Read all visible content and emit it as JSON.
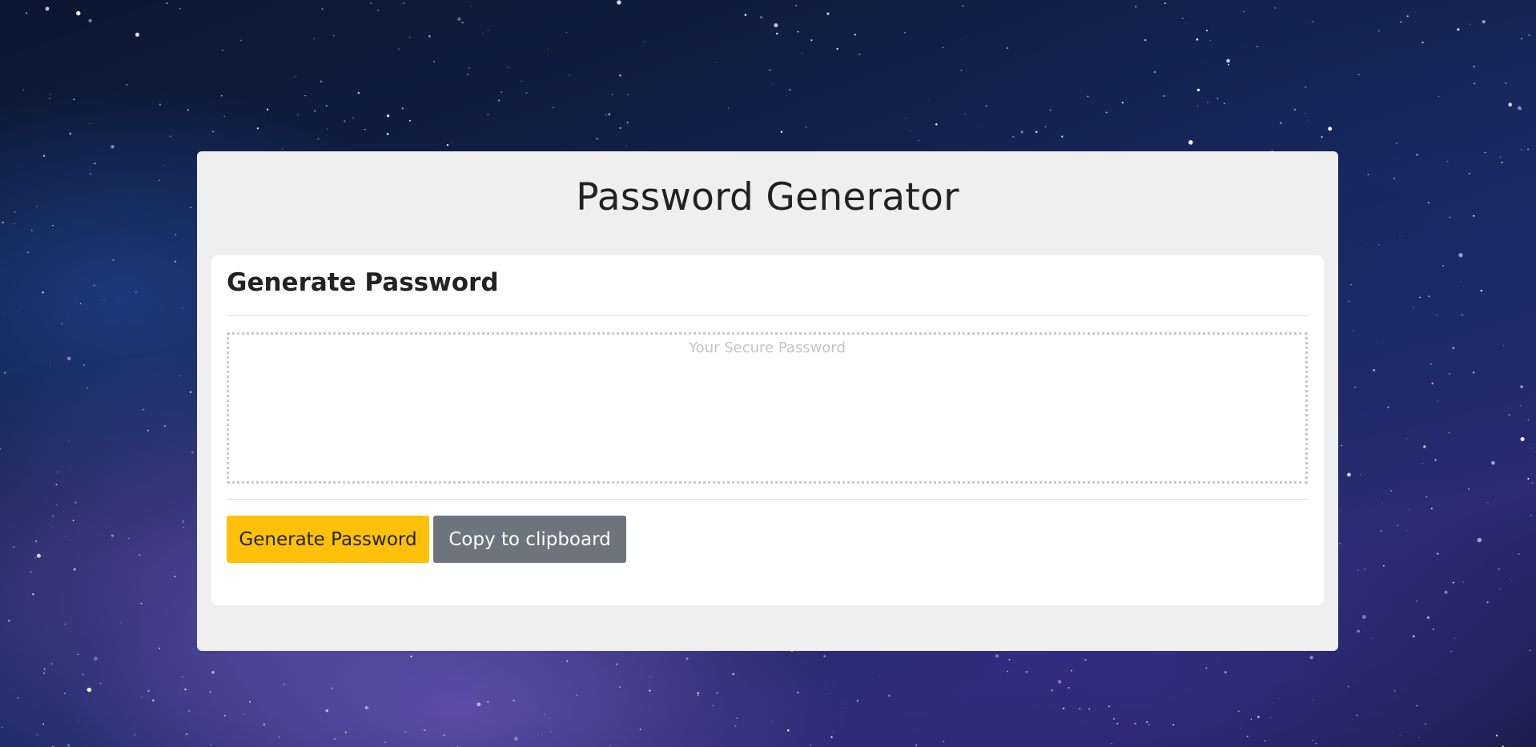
{
  "page": {
    "title": "Password Generator"
  },
  "card": {
    "title": "Generate Password",
    "password_placeholder": "Your Secure Password",
    "password_value": ""
  },
  "buttons": {
    "generate_label": "Generate Password",
    "copy_label": "Copy to clipboard"
  },
  "colors": {
    "generate_button": "#ffc107",
    "copy_button": "#6c757d",
    "panel_background": "#efefef",
    "card_background": "#ffffff"
  },
  "background": {
    "description_icon": "starry-night-sky"
  }
}
